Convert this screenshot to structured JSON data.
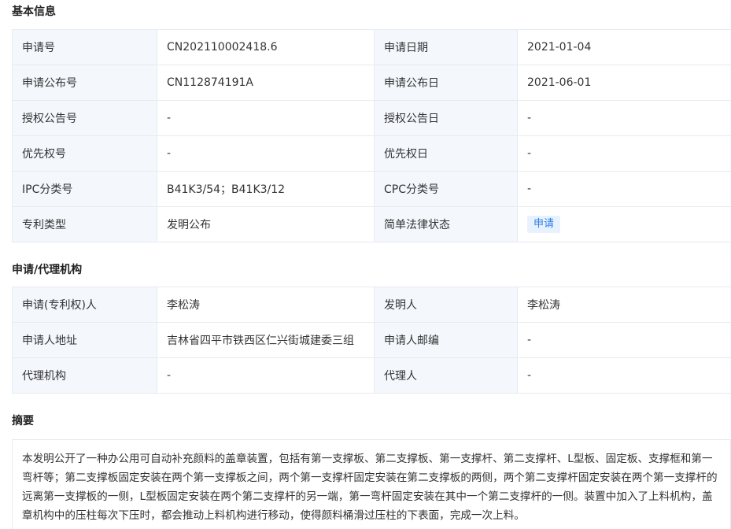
{
  "basic": {
    "title": "基本信息",
    "rows": [
      [
        "申请号",
        "CN202110002418.6",
        "申请日期",
        "2021-01-04"
      ],
      [
        "申请公布号",
        "CN112874191A",
        "申请公布日",
        "2021-06-01"
      ],
      [
        "授权公告号",
        "-",
        "授权公告日",
        "-"
      ],
      [
        "优先权号",
        "-",
        "优先权日",
        "-"
      ],
      [
        "IPC分类号",
        "B41K3/54；B41K3/12",
        "CPC分类号",
        "-"
      ],
      [
        "专利类型",
        "发明公布",
        "简单法律状态",
        "申请"
      ]
    ]
  },
  "agency": {
    "title": "申请/代理机构",
    "rows": [
      [
        "申请(专利权)人",
        "李松涛",
        "发明人",
        "李松涛"
      ],
      [
        "申请人地址",
        "吉林省四平市铁西区仁兴街城建委三组",
        "申请人邮编",
        "-"
      ],
      [
        "代理机构",
        "-",
        "代理人",
        "-"
      ]
    ]
  },
  "abstract": {
    "title": "摘要",
    "text": "本发明公开了一种办公用可自动补充颜料的盖章装置，包括有第一支撑板、第二支撑板、第一支撑杆、第二支撑杆、L型板、固定板、支撑框和第一弯杆等；第二支撑板固定安装在两个第一支撑板之间，两个第一支撑杆固定安装在第二支撑板的两侧，两个第二支撑杆固定安装在两个第一支撑杆的远离第一支撑板的一侧，L型板固定安装在两个第二支撑杆的另一端，第一弯杆固定安装在其中一个第二支撑杆的一侧。装置中加入了上料机构，盖章机构中的压柱每次下压时，都会推动上料机构进行移动，使得颜料桶滑过压柱的下表面，完成一次上料。"
  },
  "colors": {
    "label_bg": "#f4f7fc",
    "border": "#e6ebf3",
    "badge_bg": "#e8f2fe",
    "badge_text": "#2f7ce6"
  }
}
